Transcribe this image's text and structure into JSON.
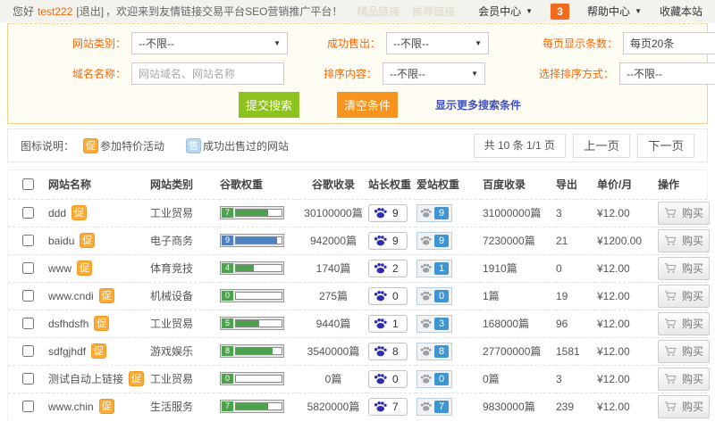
{
  "topbar": {
    "greeting_prefix": "您好",
    "username": "test222",
    "logout": "[退出]",
    "welcome": "，欢迎来到友情链接交易平台SEO营销推广平台！",
    "ghost_nav": [
      "精品链接",
      "推荐链接"
    ],
    "member_center": "会员中心",
    "notification_count": "3",
    "help_center": "帮助中心",
    "favorite": "收藏本站"
  },
  "filters": {
    "category_label": "网站类别：",
    "category_value": "--不限--",
    "sold_label": "成功售出：",
    "sold_value": "--不限--",
    "per_page_label": "每页显示条数：",
    "per_page_value": "每页20条",
    "domain_label": "域名名称：",
    "domain_placeholder": "网站域名、网站名称",
    "sort_content_label": "排序内容：",
    "sort_content_value": "--不限--",
    "sort_mode_label": "选择排序方式：",
    "sort_mode_value": "--不限--",
    "submit": "提交搜索",
    "clear": "清空条件",
    "more": "显示更多搜索条件"
  },
  "legend": {
    "title": "图标说明：",
    "promo_badge": "促",
    "promo_text": "参加特价活动",
    "sold_badge": "售",
    "sold_text": "成功出售过的网站"
  },
  "pagination": {
    "summary": "共 10 条 1/1 页",
    "prev": "上一页",
    "next": "下一页"
  },
  "table": {
    "headers": [
      "网站名称",
      "网站类别",
      "谷歌权重",
      "谷歌收录",
      "站长权重",
      "爱站权重",
      "百度收录",
      "导出",
      "单价/月",
      "操作"
    ],
    "buy_label": "购买",
    "rows": [
      {
        "name": "ddd",
        "badge": "促",
        "category": "工业贸易",
        "pr": 7,
        "pr_color": "green",
        "google_index": "30100000篇",
        "chinaz": "9",
        "aizhan": "9",
        "baidu_index": "31000000篇",
        "export": "3",
        "price": "¥12.00"
      },
      {
        "name": "baidu",
        "badge": "促",
        "category": "电子商务",
        "pr": 9,
        "pr_color": "blue",
        "google_index": "942000篇",
        "chinaz": "9",
        "aizhan": "9",
        "baidu_index": "7230000篇",
        "export": "21",
        "price": "¥1200.00"
      },
      {
        "name": "www",
        "badge": "促",
        "category": "体育竞技",
        "pr": 4,
        "pr_color": "green",
        "google_index": "1740篇",
        "chinaz": "2",
        "aizhan": "1",
        "baidu_index": "1910篇",
        "export": "0",
        "price": "¥12.00"
      },
      {
        "name": "www.cndi",
        "badge": "促",
        "category": "机械设备",
        "pr": 0,
        "pr_color": "green",
        "google_index": "275篇",
        "chinaz": "0",
        "aizhan": "0",
        "baidu_index": "1篇",
        "export": "19",
        "price": "¥12.00"
      },
      {
        "name": "dsfhdsfh",
        "badge": "促",
        "category": "工业贸易",
        "pr": 5,
        "pr_color": "green",
        "google_index": "9440篇",
        "chinaz": "1",
        "aizhan": "3",
        "baidu_index": "168000篇",
        "export": "96",
        "price": "¥12.00"
      },
      {
        "name": "sdfgjhdf",
        "badge": "促",
        "category": "游戏娱乐",
        "pr": 8,
        "pr_color": "green",
        "google_index": "3540000篇",
        "chinaz": "8",
        "aizhan": "8",
        "baidu_index": "27700000篇",
        "export": "1581",
        "price": "¥12.00"
      },
      {
        "name": "测试自动上链接",
        "badge": "促",
        "category": "工业贸易",
        "pr": 0,
        "pr_color": "green",
        "google_index": "0篇",
        "chinaz": "0",
        "aizhan": "0",
        "baidu_index": "0篇",
        "export": "3",
        "price": "¥12.00"
      },
      {
        "name": "www.chin",
        "badge": "促",
        "category": "生活服务",
        "pr": 7,
        "pr_color": "green",
        "google_index": "5820000篇",
        "chinaz": "7",
        "aizhan": "7",
        "baidu_index": "9830000篇",
        "export": "239",
        "price": "¥12.00"
      }
    ]
  },
  "colors": {
    "accent_orange": "#ff6600",
    "green_button": "#8dc21f",
    "orange_button": "#f7941e",
    "link_blue": "#3f51c1",
    "pr_green": "#4ea24e",
    "pr_blue": "#4f81bd",
    "aizhan_blue": "#3e95d2",
    "notification_orange": "#f26b1d"
  }
}
